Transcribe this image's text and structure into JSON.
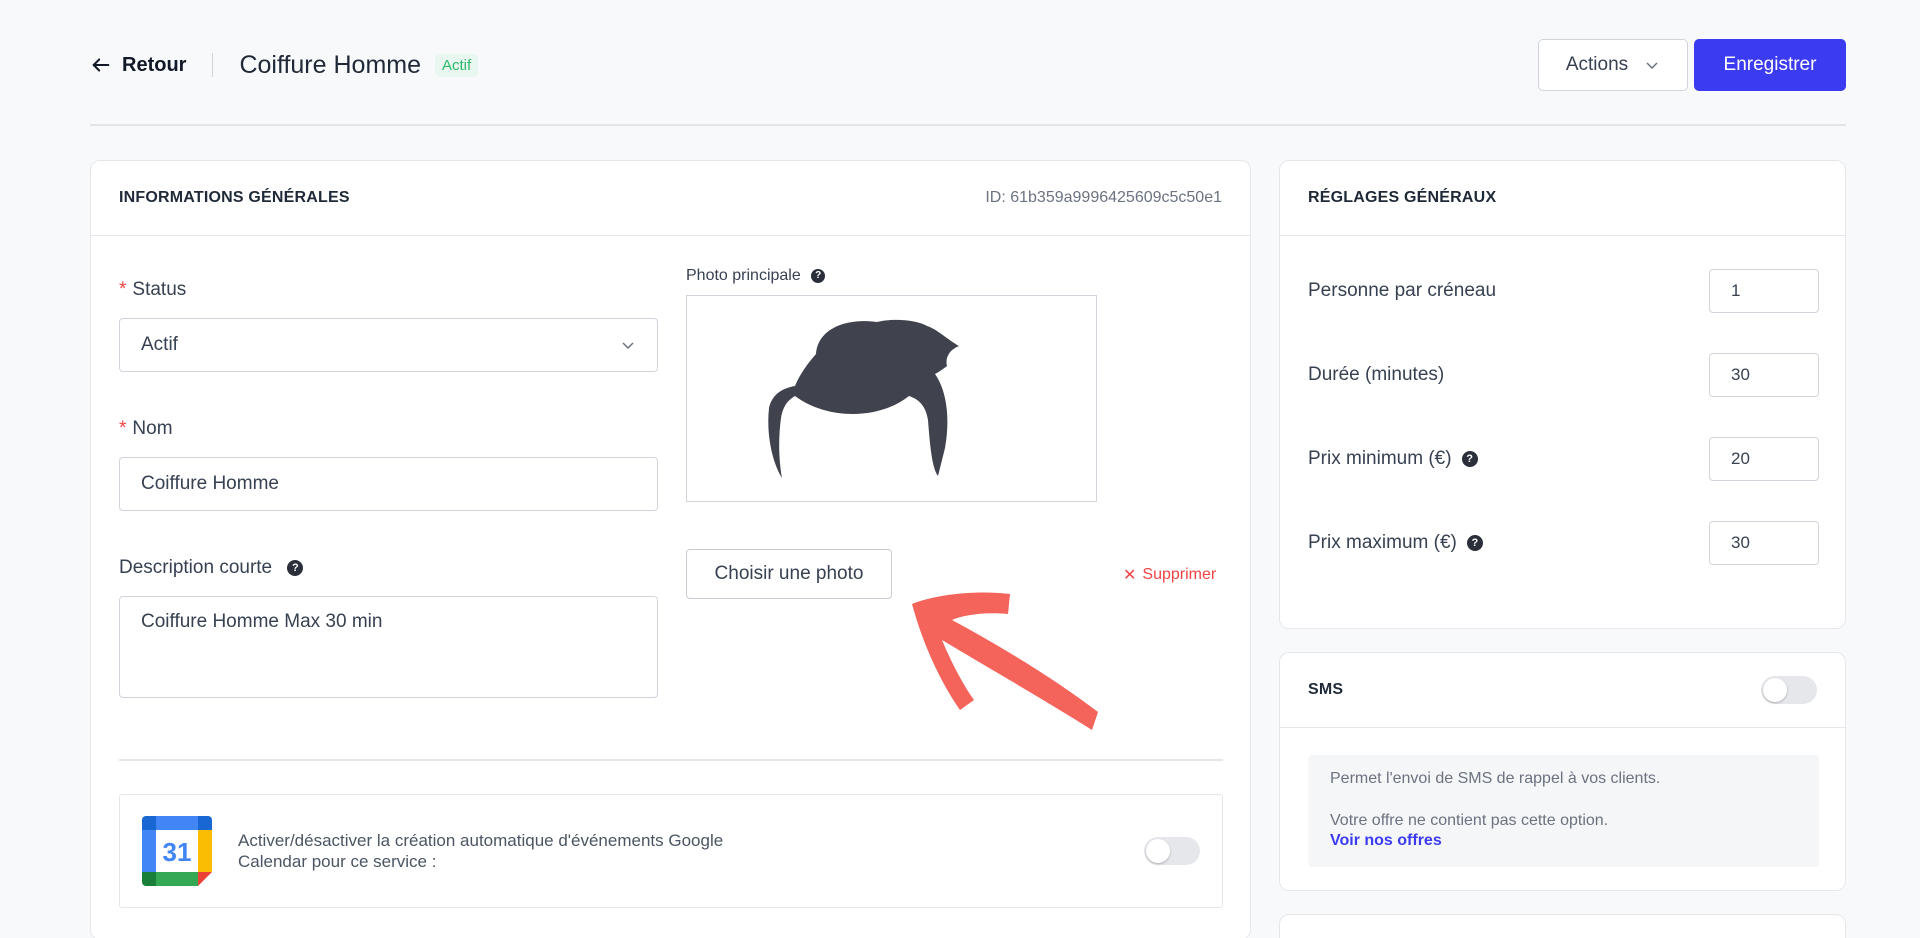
{
  "header": {
    "back_label": "Retour",
    "title": "Coiffure Homme",
    "status_badge": "Actif",
    "actions_label": "Actions",
    "save_label": "Enregistrer"
  },
  "general": {
    "heading": "INFORMATIONS GÉNÉRALES",
    "id_text": "ID: 61b359a9996425609c5c50e1",
    "required_mark": "*",
    "status_label": "Status",
    "status_value": "Actif",
    "name_label": "Nom",
    "name_value": "Coiffure Homme",
    "desc_label": "Description courte",
    "desc_value": "Coiffure Homme Max 30 min",
    "help_glyph": "?",
    "photo_label": "Photo principale",
    "choose_photo": "Choisir une photo",
    "delete_label": "Supprimer",
    "delete_glyph": "✕",
    "gcal_text": "Activer/désactiver la création automatique d'événements Google Calendar pour ce service :",
    "gcal_icon_day": "31"
  },
  "settings": {
    "heading": "RÉGLAGES GÉNÉRAUX",
    "rows": [
      {
        "label": "Personne par créneau",
        "value": "1"
      },
      {
        "label": "Durée (minutes)",
        "value": "30"
      },
      {
        "label": "Prix minimum (€)",
        "value": "20"
      },
      {
        "label": "Prix maximum (€)",
        "value": "30"
      }
    ]
  },
  "sms": {
    "heading": "SMS",
    "info_line1": "Permet l'envoi de SMS de rappel à vos clients.",
    "info_line2": "Votre offre ne contient pas cette option.",
    "link": "Voir nos offres"
  },
  "colors": {
    "primary": "#3b3bf2",
    "active_badge_bg": "#e8f7ef",
    "active_badge_text": "#2fb76b",
    "danger": "#ef4444",
    "annotation_arrow": "#f4645a"
  },
  "icons": [
    "arrow-left-icon",
    "chevron-down-icon",
    "help-icon",
    "close-icon",
    "google-calendar-icon",
    "hair-placeholder-icon"
  ]
}
